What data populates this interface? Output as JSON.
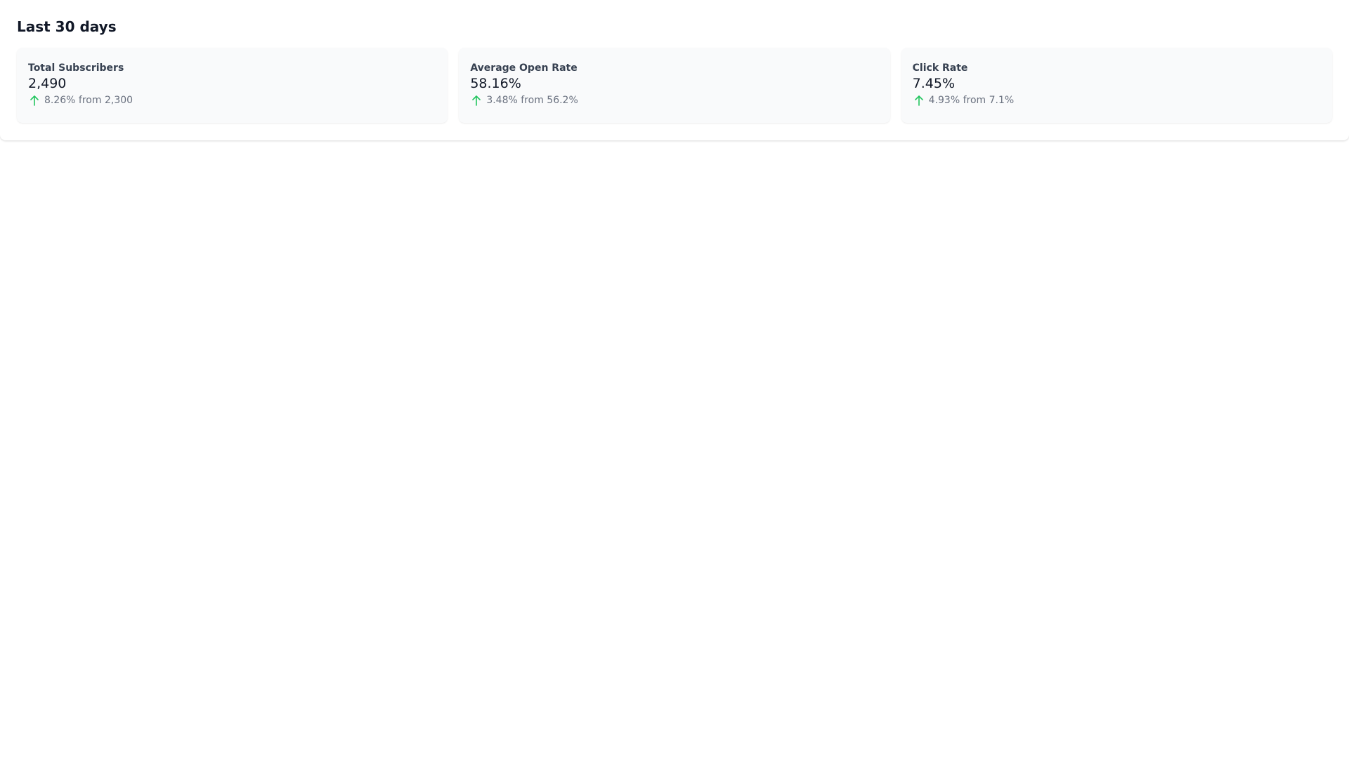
{
  "header": {
    "title": "Last 30 days"
  },
  "stats": [
    {
      "label": "Total Subscribers",
      "value": "2,490",
      "change": "8.26% from 2,300",
      "trend_icon": "arrow-up-icon"
    },
    {
      "label": "Average Open Rate",
      "value": "58.16%",
      "change": "3.48% from 56.2%",
      "trend_icon": "arrow-up-icon"
    },
    {
      "label": "Click Rate",
      "value": "7.45%",
      "change": "4.93% from 7.1%",
      "trend_icon": "arrow-up-icon"
    }
  ],
  "colors": {
    "trend_up": "#22c55e",
    "card_background": "#f9fafb",
    "label_text": "#374151",
    "muted_text": "#6b7280"
  }
}
